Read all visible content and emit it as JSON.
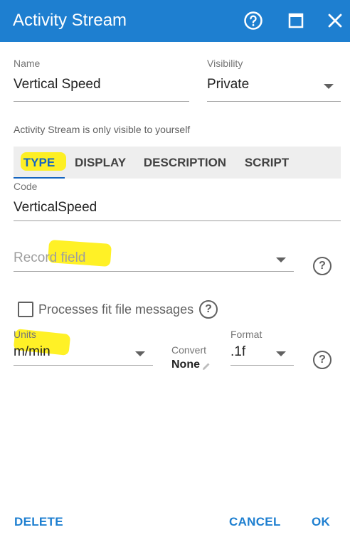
{
  "window": {
    "title": "Activity Stream",
    "buttons": [
      "help-icon",
      "maximize-icon",
      "close-icon"
    ]
  },
  "name_field": {
    "label": "Name",
    "value": "Vertical Speed"
  },
  "visibility_field": {
    "label": "Visibility",
    "value": "Private"
  },
  "visibility_note": "Activity Stream is only visible to yourself",
  "tabs": [
    {
      "label": "TYPE",
      "active": true
    },
    {
      "label": "DISPLAY",
      "active": false
    },
    {
      "label": "DESCRIPTION",
      "active": false
    },
    {
      "label": "SCRIPT",
      "active": false
    }
  ],
  "code_field": {
    "label": "Code",
    "value": "VerticalSpeed"
  },
  "record_field": {
    "placeholder": "Record field"
  },
  "fit_checkbox": {
    "label": "Processes fit file messages",
    "checked": false
  },
  "units_field": {
    "label": "Units",
    "value": "m/min"
  },
  "convert": {
    "label": "Convert",
    "value": "None"
  },
  "format_field": {
    "label": "Format",
    "value": ".1f"
  },
  "footer": {
    "delete": "DELETE",
    "cancel": "CANCEL",
    "ok": "OK"
  },
  "colors": {
    "titlebar": "#1e7fd0",
    "accent": "#1565c0",
    "highlight": "#ffee00"
  }
}
